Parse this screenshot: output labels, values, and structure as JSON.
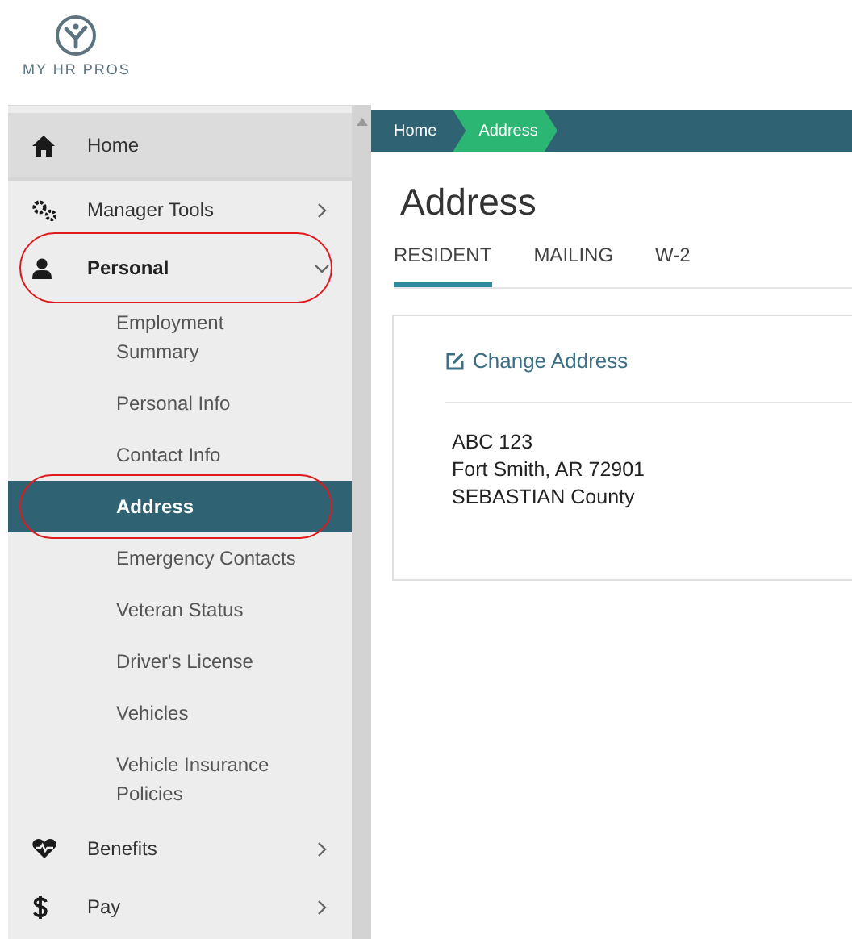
{
  "logo": {
    "text": "MY HR PROS"
  },
  "sidebar": {
    "items": [
      {
        "label": "Home",
        "hovered": true,
        "expandable": false,
        "expanded": false,
        "circled": false
      },
      {
        "label": "Manager Tools",
        "hovered": false,
        "expandable": true,
        "expanded": false,
        "circled": false
      },
      {
        "label": "Personal",
        "hovered": false,
        "expandable": true,
        "expanded": true,
        "circled": true,
        "children": [
          {
            "label": "Employment Summary",
            "selected": false,
            "circled": false
          },
          {
            "label": "Personal Info",
            "selected": false,
            "circled": false
          },
          {
            "label": "Contact Info",
            "selected": false,
            "circled": false
          },
          {
            "label": "Address",
            "selected": true,
            "circled": true
          },
          {
            "label": "Emergency Contacts",
            "selected": false,
            "circled": false
          },
          {
            "label": "Veteran Status",
            "selected": false,
            "circled": false
          },
          {
            "label": "Driver's License",
            "selected": false,
            "circled": false
          },
          {
            "label": "Vehicles",
            "selected": false,
            "circled": false
          },
          {
            "label": "Vehicle Insurance Policies",
            "selected": false,
            "circled": false
          }
        ]
      },
      {
        "label": "Benefits",
        "hovered": false,
        "expandable": true,
        "expanded": false,
        "circled": false
      },
      {
        "label": "Pay",
        "hovered": false,
        "expandable": true,
        "expanded": false,
        "circled": false
      }
    ]
  },
  "breadcrumb": [
    {
      "label": "Home",
      "selected": false
    },
    {
      "label": "Address",
      "selected": true
    }
  ],
  "page_title": "Address",
  "tabs": [
    {
      "label": "RESIDENT",
      "selected": true
    },
    {
      "label": "MAILING",
      "selected": false
    },
    {
      "label": "W-2",
      "selected": false
    }
  ],
  "card": {
    "link": "Change Address",
    "address_lines": [
      "ABC 123",
      "Fort Smith, AR 72901",
      "SEBASTIAN County"
    ]
  }
}
